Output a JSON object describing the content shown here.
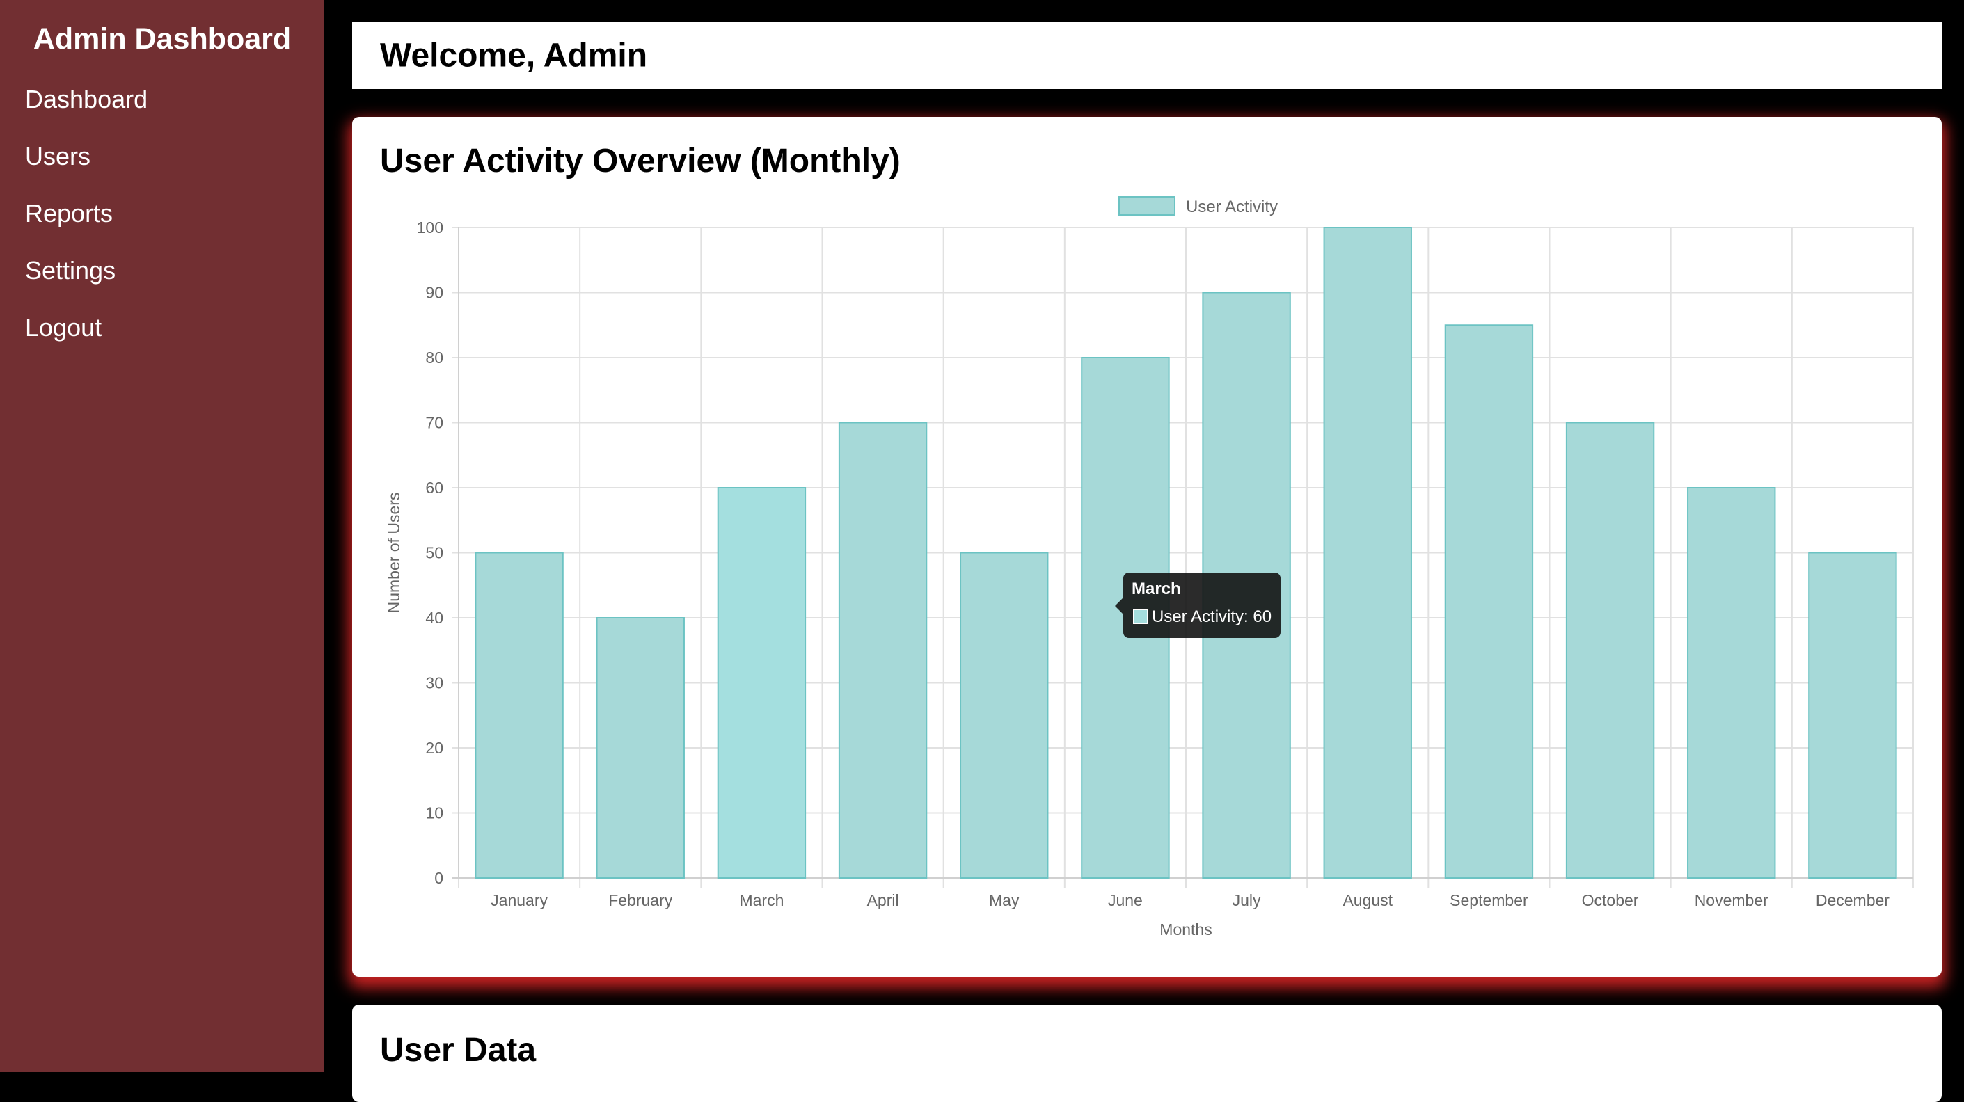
{
  "sidebar": {
    "brand": "Admin Dashboard",
    "items": [
      {
        "label": "Dashboard"
      },
      {
        "label": "Users"
      },
      {
        "label": "Reports"
      },
      {
        "label": "Settings"
      },
      {
        "label": "Logout"
      }
    ]
  },
  "header": {
    "title": "Welcome, Admin"
  },
  "chart_section": {
    "title": "User Activity Overview (Monthly)"
  },
  "tooltip": {
    "title": "March",
    "label": "User Activity: 60"
  },
  "user_section": {
    "title": "User Data"
  },
  "colors": {
    "sidebar": "#722F32",
    "bar_fill": "#A6D9D8",
    "bar_border": "#6CC3C3",
    "bar_hover": "#A4DFDF",
    "card_glow": "#DC2626"
  },
  "chart_data": {
    "type": "bar",
    "categories": [
      "January",
      "February",
      "March",
      "April",
      "May",
      "June",
      "July",
      "August",
      "September",
      "October",
      "November",
      "December"
    ],
    "series": [
      {
        "name": "User Activity",
        "values": [
          50,
          40,
          60,
          70,
          50,
          80,
          90,
          100,
          85,
          70,
          60,
          50
        ]
      }
    ],
    "xlabel": "Months",
    "ylabel": "Number of Users",
    "ylim": [
      0,
      100
    ],
    "yticks": [
      0,
      10,
      20,
      30,
      40,
      50,
      60,
      70,
      80,
      90,
      100
    ],
    "grid": true,
    "legend": "top-center",
    "highlighted_category": "March"
  }
}
